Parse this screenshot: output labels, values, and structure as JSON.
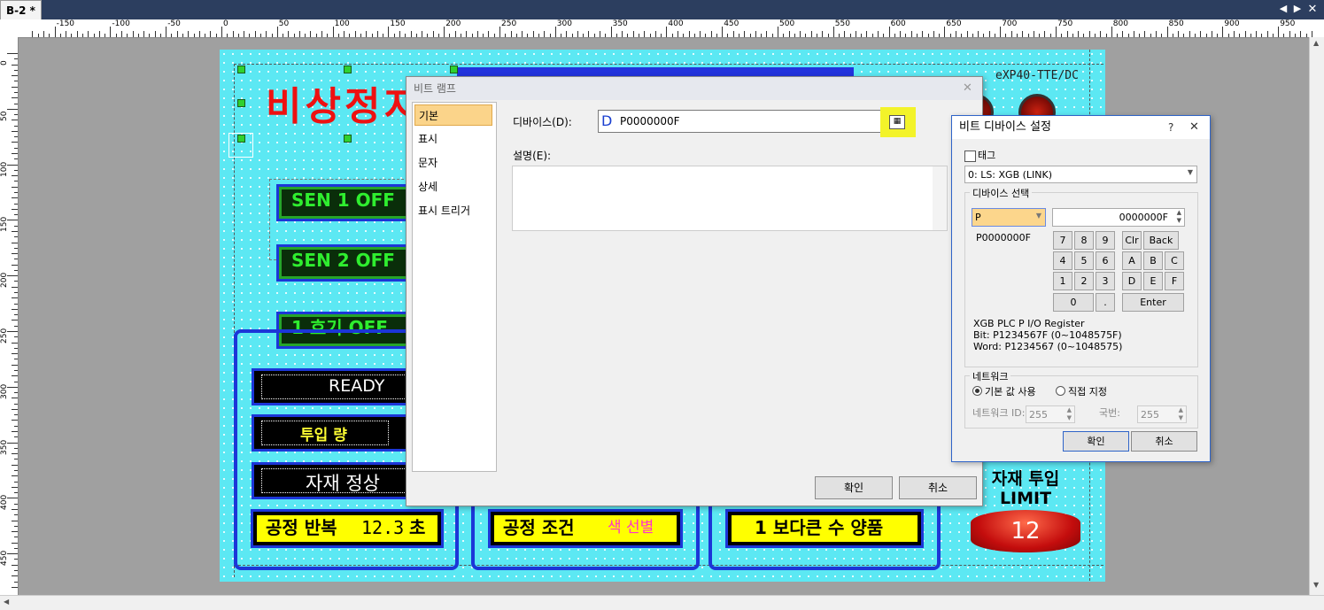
{
  "tab": {
    "label": "B-2 *"
  },
  "ruler": {
    "h_labels": [
      "-150",
      "-100",
      "-50",
      "0",
      "50",
      "100",
      "150",
      "200",
      "250",
      "300",
      "350",
      "400",
      "450",
      "500",
      "550",
      "600",
      "650",
      "700",
      "750",
      "800",
      "850",
      "900",
      "950"
    ],
    "v_labels": [
      "0",
      "50",
      "100",
      "150",
      "200",
      "250",
      "300",
      "350",
      "400",
      "450"
    ]
  },
  "screen": {
    "title": "비상정지",
    "model": "eXP40-TTE/DC",
    "lamps": [
      "SEN 1  OFF",
      "SEN 2  OFF",
      "1 호기 OFF"
    ],
    "messages": [
      "READY",
      "투입 량",
      "자재  정상"
    ],
    "yellow_boxes": [
      {
        "text": "공정 반복",
        "value": "12.3",
        "unit": "초"
      },
      {
        "text": "공정 조건",
        "accent": "색 선별"
      },
      {
        "text": "1  보다큰 수 양품"
      }
    ],
    "limit_label": "자재 투입 LIMIT",
    "counter_value": "12"
  },
  "bit_lamp_dialog": {
    "title": "비트 램프",
    "nav": [
      "기본",
      "표시",
      "문자",
      "상세",
      "표시 트리거"
    ],
    "device_label": "디바이스(D):",
    "device_value": "P0000000F",
    "device_prefix": "D",
    "desc_label": "설명(E):",
    "ok": "확인",
    "cancel": "취소"
  },
  "bit_device_dialog": {
    "title": "비트 디바이스 설정",
    "help": "?",
    "tag_label": "태그",
    "plc": "0: LS: XGB (LINK)",
    "device_group": "디바이스 선택",
    "device_type": "P",
    "address": "0000000F",
    "preview": "P0000000F",
    "keys": [
      "7",
      "8",
      "9",
      "Clr",
      "Back",
      "4",
      "5",
      "6",
      "A",
      "B",
      "C",
      "1",
      "2",
      "3",
      "D",
      "E",
      "F",
      "0",
      ".",
      "Enter"
    ],
    "info": [
      "XGB PLC P I/O Register",
      "Bit: P1234567F (0~1048575F)",
      "Word: P1234567 (0~1048575)"
    ],
    "network_group": "네트워크",
    "radio_default": "기본 값 사용",
    "radio_direct": "직접 지정",
    "network_id_label": "네트워크 ID:",
    "network_id": "255",
    "station_label": "국번:",
    "station": "255",
    "ok": "확인",
    "cancel": "취소"
  }
}
